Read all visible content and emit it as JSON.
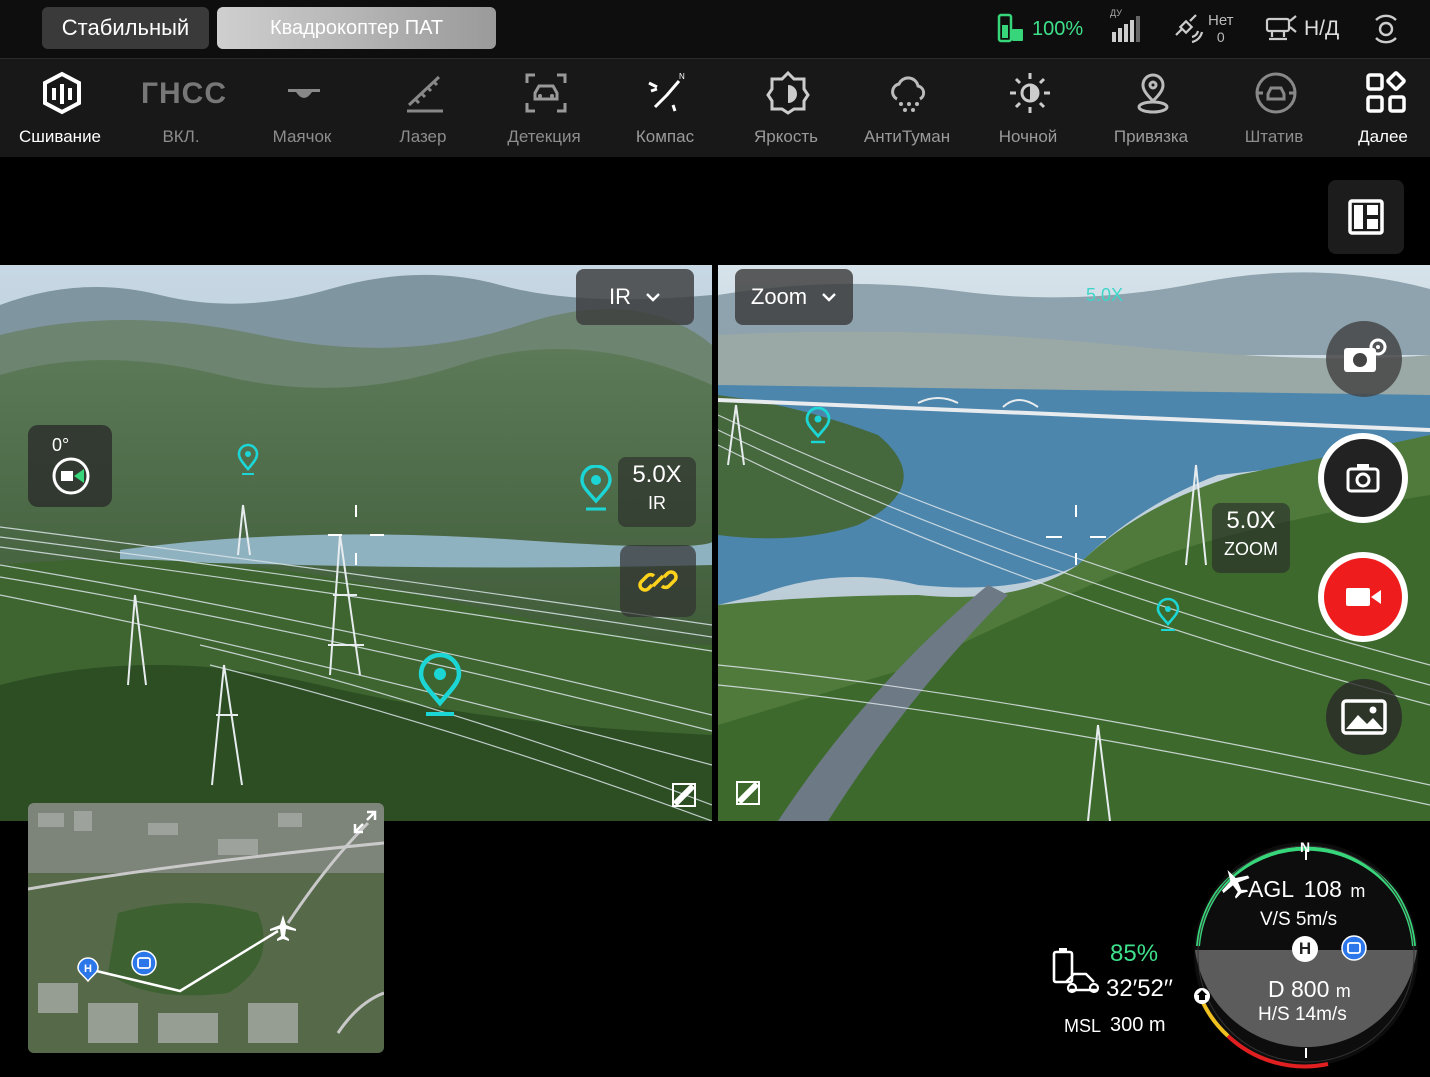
{
  "topbar": {
    "mode": "Стабильный",
    "device": "Квадрокоптер ПАТ",
    "battery": "100%",
    "rc_label": "ДУ",
    "satellite_top": "Нет",
    "satellite_bottom": "0",
    "nd": "Н/Д"
  },
  "toolbar": {
    "items": [
      {
        "label": "Сшивание",
        "icon": "stitch-icon"
      },
      {
        "label": "ВКЛ.",
        "icon": "gnss-icon",
        "icon_text": "ГНСС"
      },
      {
        "label": "Маячок",
        "icon": "beacon-icon"
      },
      {
        "label": "Лазер",
        "icon": "laser-icon"
      },
      {
        "label": "Детекция",
        "icon": "detection-icon"
      },
      {
        "label": "Компас",
        "icon": "compass-icon"
      },
      {
        "label": "Яркость",
        "icon": "brightness-icon"
      },
      {
        "label": "АнтиТуман",
        "icon": "defog-icon"
      },
      {
        "label": "Ночной",
        "icon": "night-icon"
      },
      {
        "label": "Привязка",
        "icon": "location-pin-icon"
      },
      {
        "label": "Штатив",
        "icon": "tripod-icon"
      },
      {
        "label": "Далее",
        "icon": "more-grid-icon"
      }
    ]
  },
  "ir_view": {
    "lens": "IR",
    "zoom_value": "5.0X",
    "zoom_label": "IR",
    "gimbal_angle": "0°"
  },
  "zoom_view": {
    "lens": "Zoom",
    "zoom_indicator": "5.0X",
    "zoom_value": "5.0X",
    "zoom_label": "ZOOM"
  },
  "flight": {
    "battery_percent": "85%",
    "flight_time": "32′52′′",
    "msl_label": "MSL",
    "msl_value": "300 m",
    "agl_label": "AGL",
    "agl_value": "108",
    "agl_unit": "m",
    "vs": "V/S 5m/s",
    "d_label": "D",
    "d_value": "800",
    "d_unit": "m",
    "hs": "H/S 14m/s",
    "north": "N",
    "home_marker": "H"
  },
  "colors": {
    "accent_green": "#3ee08a",
    "pin_cyan": "#1cd6d6",
    "record_red": "#ee1c1c",
    "link_yellow": "#ffd21c"
  }
}
